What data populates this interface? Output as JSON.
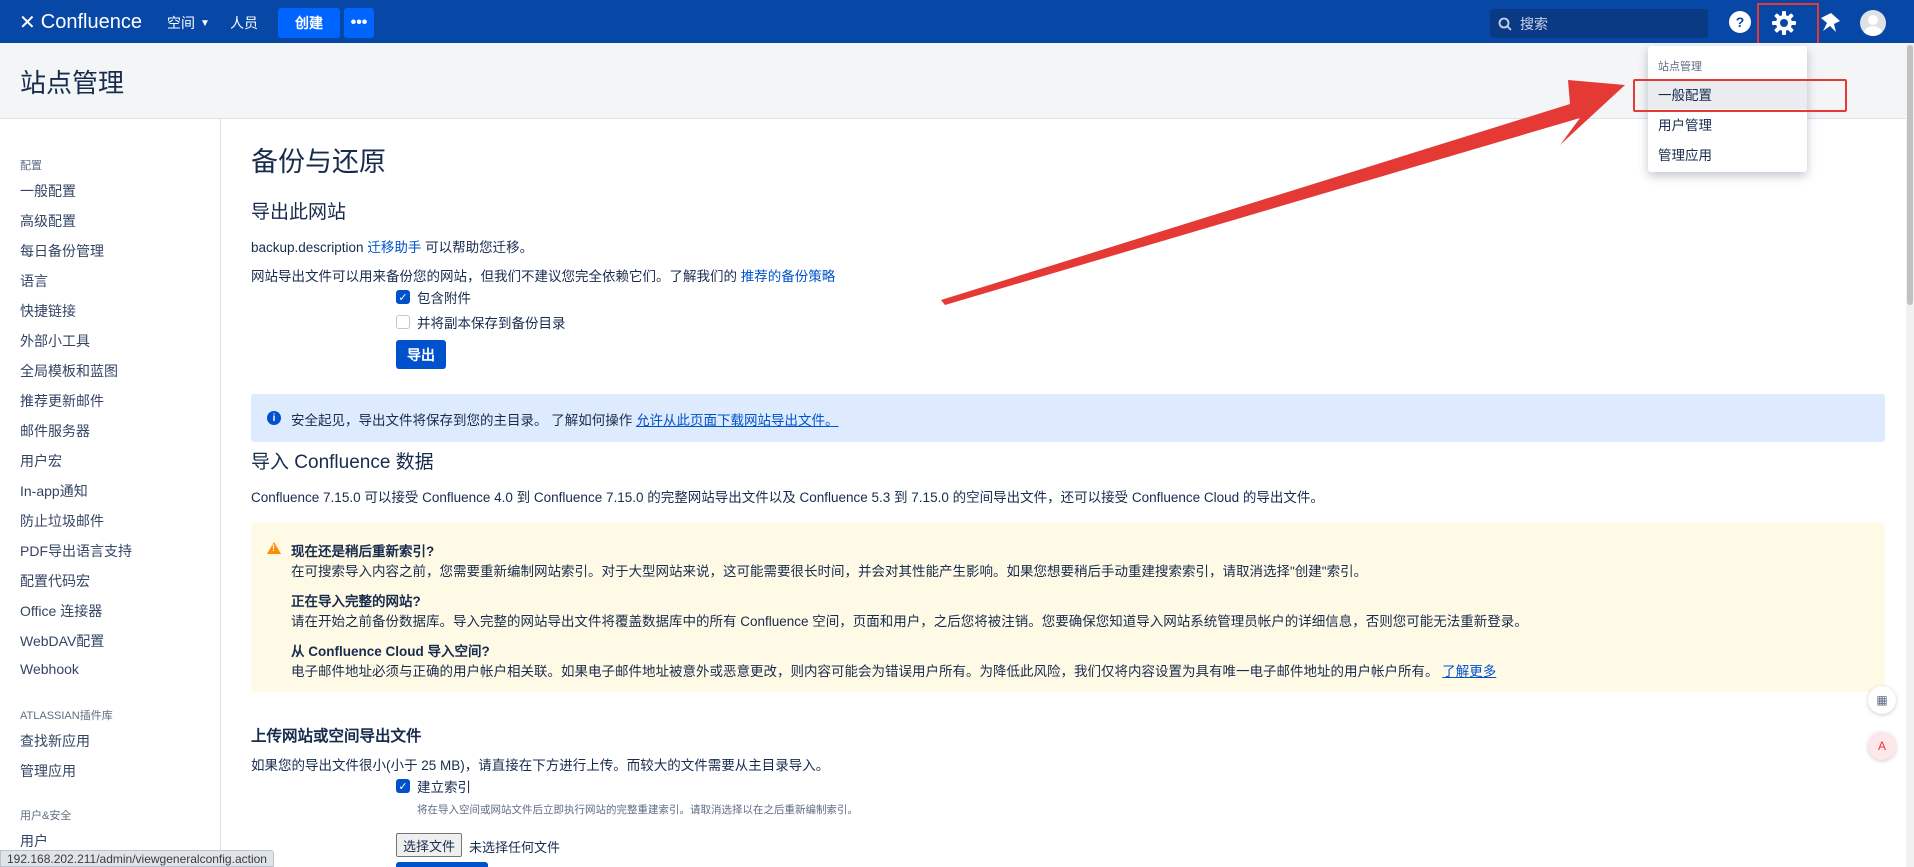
{
  "topnav": {
    "logo_text": "Confluence",
    "spaces_label": "空间",
    "people_label": "人员",
    "create_label": "创建",
    "more_label": "•••",
    "search_placeholder": "搜索",
    "help_glyph": "?"
  },
  "page": {
    "title": "站点管理"
  },
  "sidebar": {
    "section_config": "配置",
    "config_items": [
      "一般配置",
      "高级配置",
      "每日备份管理",
      "语言",
      "快捷链接",
      "外部小工具",
      "全局模板和蓝图",
      "推荐更新邮件",
      "邮件服务器",
      "用户宏",
      "In-app通知",
      "防止垃圾邮件",
      "PDF导出语言支持",
      "配置代码宏",
      "Office 连接器",
      "WebDAV配置",
      "Webhook"
    ],
    "section_plugins": "ATLASSIAN插件库",
    "plugin_items": [
      "查找新应用",
      "管理应用"
    ],
    "section_security": "用户&安全",
    "security_items": [
      "用户"
    ]
  },
  "main": {
    "heading": "备份与还原",
    "export": {
      "title": "导出此网站",
      "desc_prefix": "backup.description",
      "desc_link": "迁移助手",
      "desc_suffix": "可以帮助您迁移。",
      "warn_text": "网站导出文件可以用来备份您的网站，但我们不建议您完全依赖它们。了解我们的",
      "warn_link": "推荐的备份策略",
      "include_attachments": "包含附件",
      "save_copy": "并将副本保存到备份目录",
      "export_button": "导出"
    },
    "info_message": "安全起见，导出文件将保存到您的主目录。 了解如何操作",
    "info_link": "允许从此页面下载网站导出文件。",
    "import": {
      "title": "导入 Confluence 数据",
      "desc": "Confluence 7.15.0 可以接受 Confluence 4.0 到 Confluence 7.15.0 的完整网站导出文件以及 Confluence 5.3 到 7.15.0 的空间导出文件，还可以接受 Confluence Cloud 的导出文件。"
    },
    "warning": {
      "q1": "现在还是稍后重新索引?",
      "a1": "在可搜索导入内容之前，您需要重新编制网站索引。对于大型网站来说，这可能需要很长时间，并会对其性能产生影响。如果您想要稍后手动重建搜索索引，请取消选择\"创建\"索引。",
      "q2": "正在导入完整的网站?",
      "a2": "请在开始之前备份数据库。导入完整的网站导出文件将覆盖数据库中的所有 Confluence 空间，页面和用户，之后您将被注销。您要确保您知道导入网站系统管理员帐户的详细信息，否则您可能无法重新登录。",
      "q3": "从 Confluence Cloud 导入空间?",
      "a3": "电子邮件地址必须与正确的用户帐户相关联。如果电子邮件地址被意外或恶意更改，则内容可能会为错误用户所有。为降低此风险，我们仅将内容设置为具有唯一电子邮件地址的用户帐户所有。",
      "learn_more": "了解更多"
    },
    "upload": {
      "title": "上传网站或空间导出文件",
      "desc": "如果您的导出文件很小(小于 25 MB)，请直接在下方进行上传。而较大的文件需要从主目录导入。",
      "build_index": "建立索引",
      "build_index_hint": "将在导入空间或网站文件后立即执行网站的完整重建索引。请取消选择以在之后重新编制索引。",
      "choose_file": "选择文件",
      "no_file": "未选择任何文件"
    }
  },
  "dropdown": {
    "header": "站点管理",
    "items": [
      "一般配置",
      "用户管理",
      "管理应用"
    ]
  },
  "status_bar": {
    "url": "192.168.202.211/admin/viewgeneralconfig.action"
  },
  "colors": {
    "nav": "#0747a6",
    "accent": "#0052cc",
    "annotation": "#e53935"
  }
}
